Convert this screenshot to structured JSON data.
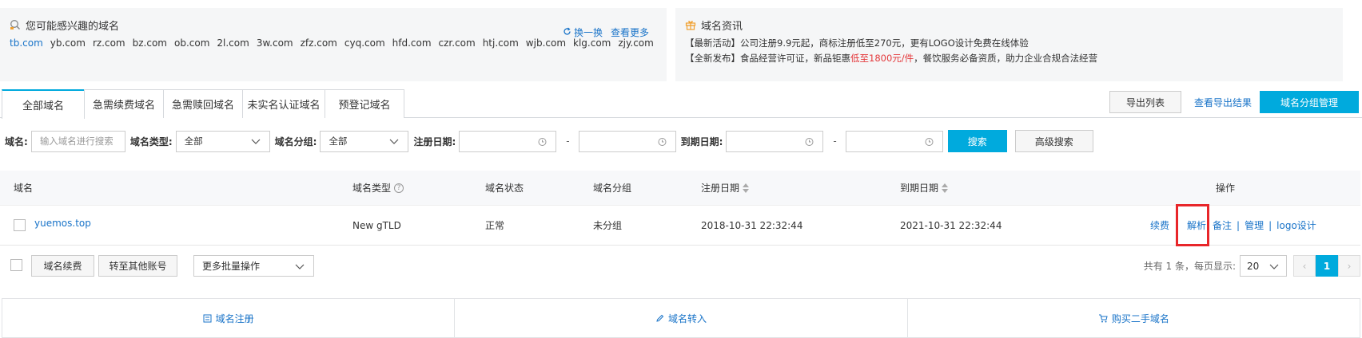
{
  "recommend": {
    "title": "您可能感兴趣的域名",
    "refresh_label": "换一换",
    "more_label": "查看更多",
    "domains": [
      "tb.com",
      "yb.com",
      "rz.com",
      "bz.com",
      "ob.com",
      "2l.com",
      "3w.com",
      "zfz.com",
      "cyq.com",
      "hfd.com",
      "czr.com",
      "htj.com",
      "wjb.com",
      "klg.com",
      "zjy.com"
    ]
  },
  "news": {
    "title": "域名资讯",
    "line1": "【最新活动】公司注册9.9元起，商标注册低至270元，更有LOGO设计免费在线体验",
    "line2_pre": "【全新发布】食品经营许可证，新品钜惠",
    "line2_hl": "低至1800元/件",
    "line2_post": "，餐饮服务必备资质，助力企业合规合法经营"
  },
  "tabs": [
    "全部域名",
    "急需续费域名",
    "急需赎回域名",
    "未实名认证域名",
    "预登记域名"
  ],
  "toolbar": {
    "export_label": "导出列表",
    "export_result_label": "查看导出结果",
    "group_manage_label": "域名分组管理"
  },
  "filters": {
    "domain_label": "域名:",
    "domain_placeholder": "输入域名进行搜索",
    "type_label": "域名类型:",
    "type_value": "全部",
    "group_label": "域名分组:",
    "group_value": "全部",
    "reg_label": "注册日期:",
    "exp_label": "到期日期:",
    "dash": "-",
    "search_label": "搜索",
    "advanced_label": "高级搜索"
  },
  "table": {
    "headers": [
      "域名",
      "域名类型",
      "域名状态",
      "域名分组",
      "注册日期",
      "到期日期",
      "操作"
    ],
    "rows": [
      {
        "domain": "yuemos.top",
        "type": "New gTLD",
        "status": "正常",
        "group": "未分组",
        "reg": "2018-10-31 22:32:44",
        "exp": "2021-10-31 22:32:44"
      }
    ],
    "actions": [
      "续费",
      "解析",
      "备注",
      "管理",
      "logo设计"
    ],
    "sep": "|"
  },
  "bottom": {
    "renew_label": "域名续费",
    "transfer_label": "转至其他账号",
    "bulk_label": "更多批量操作",
    "total_text": "共有 1 条，每页显示:",
    "page_size": "20",
    "prev": "‹",
    "next": "›",
    "current_page": "1"
  },
  "footer": {
    "register_label": "域名注册",
    "transfer_in_label": "域名转入",
    "buy_label": "购买二手域名"
  },
  "colors": {
    "accent": "#00aadd",
    "link": "#1873c8",
    "highlight": "#e8262a"
  }
}
